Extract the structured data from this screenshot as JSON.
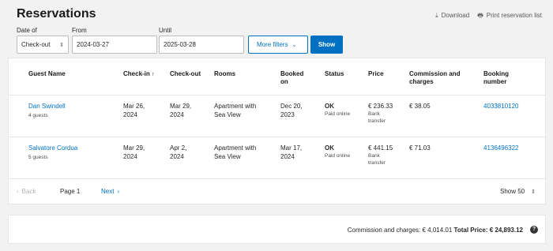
{
  "page": {
    "title": "Reservations"
  },
  "actions": {
    "download_label": "Download",
    "download_icon": "download-icon",
    "print_label": "Print reservation list",
    "print_icon": "printer-icon"
  },
  "filters": {
    "date_of_label": "Date of",
    "date_of_value": "Check-out",
    "from_label": "From",
    "from_value": "2024-03-27",
    "until_label": "Until",
    "until_value": "2025-03-28",
    "more_filters_label": "More filters",
    "show_label": "Show"
  },
  "table": {
    "headers": {
      "guest": "Guest Name",
      "checkin": "Check-in",
      "checkout": "Check-out",
      "rooms": "Rooms",
      "booked_on_1": "Booked",
      "booked_on_2": "on",
      "status": "Status",
      "price": "Price",
      "commission_1": "Commission and",
      "commission_2": "charges",
      "booking_1": "Booking",
      "booking_2": "number"
    },
    "sort_indicator": "↑",
    "rows": [
      {
        "guest_name": "Dan Swindell",
        "guests": "4 guests",
        "checkin_1": "Mar 26,",
        "checkin_2": "2024",
        "checkout_1": "Mar 29,",
        "checkout_2": "2024",
        "room_1": "Apartment with",
        "room_2": "Sea View",
        "booked_1": "Dec 20,",
        "booked_2": "2023",
        "status": "OK",
        "status_sub": "Paid online",
        "price": "€ 236.33",
        "price_sub_1": "Bank",
        "price_sub_2": "transfer",
        "commission": "€ 38.05",
        "booking_number": "4033810120"
      },
      {
        "guest_name": "Salvatore Cordua",
        "guests": "5 guests",
        "checkin_1": "Mar 29,",
        "checkin_2": "2024",
        "checkout_1": "Apr 2,",
        "checkout_2": "2024",
        "room_1": "Apartment with",
        "room_2": "Sea View",
        "booked_1": "Mar 17,",
        "booked_2": "2024",
        "status": "OK",
        "status_sub": "Paid online",
        "price": "€ 441.15",
        "price_sub_1": "Bank",
        "price_sub_2": "transfer",
        "commission": "€ 71.03",
        "booking_number": "4136496322"
      }
    ]
  },
  "pagination": {
    "back_label": "Back",
    "page_label": "Page 1",
    "next_label": "Next",
    "show_label": "Show 50"
  },
  "footer": {
    "commission_text": "Commission and charges: € 4,014.01",
    "total_text": "Total Price: € 24,893.12",
    "help_glyph": "?"
  }
}
